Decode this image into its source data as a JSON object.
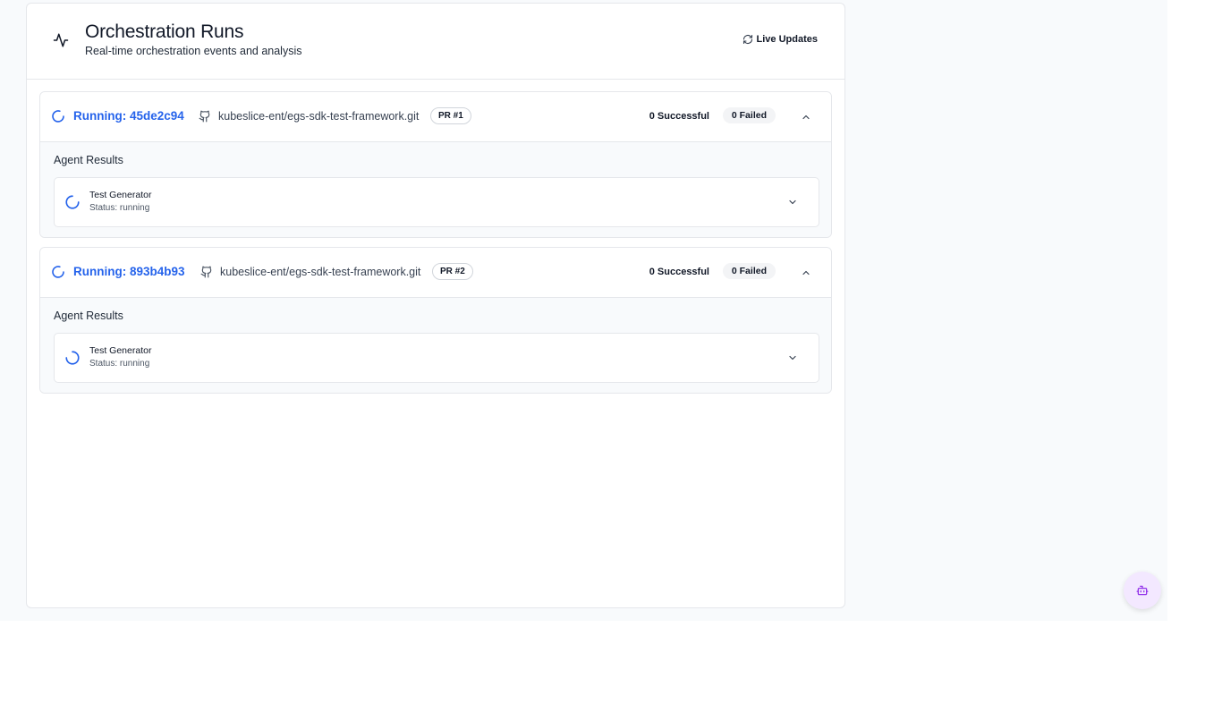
{
  "header": {
    "title": "Orchestration Runs",
    "subtitle": "Real-time orchestration events and analysis",
    "live_updates_label": "Live Updates",
    "icon": "activity-icon"
  },
  "runs": [
    {
      "title": "Running: 45de2c94",
      "repo": "kubeslice-ent/egs-sdk-test-framework.git",
      "pr": "PR #1",
      "successful": "0 Successful",
      "failed": "0 Failed",
      "agent_results_label": "Agent Results",
      "agents": [
        {
          "name": "Test Generator",
          "status": "Status: running"
        }
      ]
    },
    {
      "title": "Running: 893b4b93",
      "repo": "kubeslice-ent/egs-sdk-test-framework.git",
      "pr": "PR #2",
      "successful": "0 Successful",
      "failed": "0 Failed",
      "agent_results_label": "Agent Results",
      "agents": [
        {
          "name": "Test Generator",
          "status": "Status: running"
        }
      ]
    }
  ],
  "colors": {
    "accent": "#2563eb",
    "fab_bg": "#f3e8ff",
    "fab_icon": "#9333ea"
  },
  "fab": {
    "icon": "bot-icon"
  }
}
